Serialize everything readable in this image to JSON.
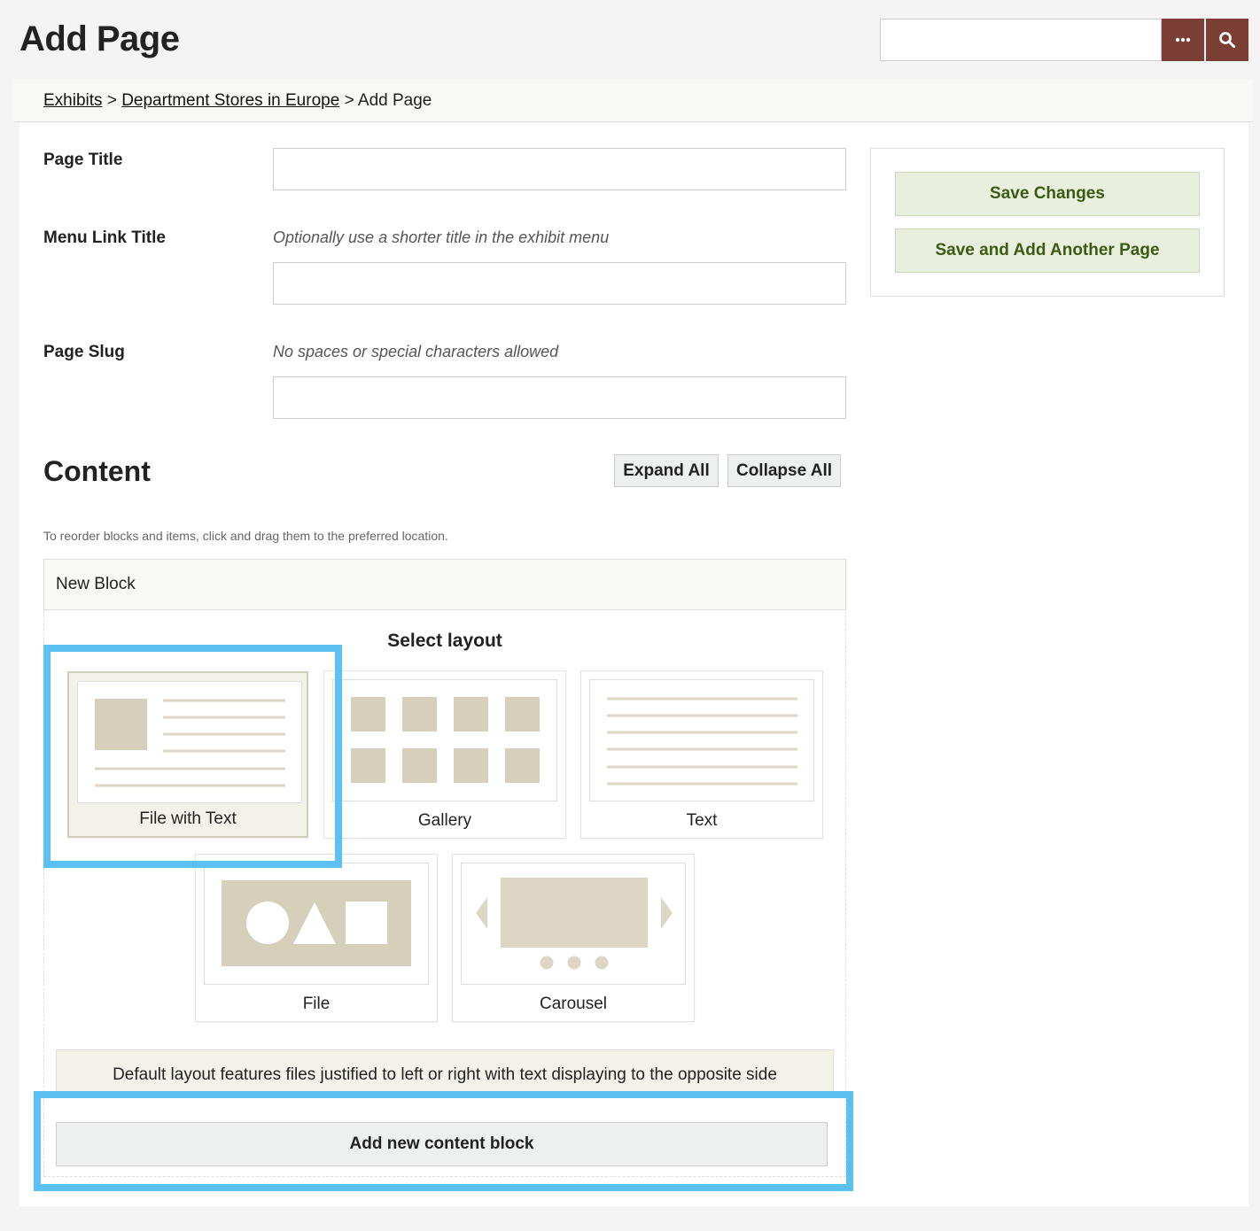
{
  "header": {
    "title": "Add Page"
  },
  "search": {
    "value": "",
    "options_icon": "ellipsis-icon",
    "submit_icon": "magnifier-icon",
    "button_color": "#7a3e35"
  },
  "breadcrumb": {
    "items": [
      {
        "label": "Exhibits",
        "link": true
      },
      {
        "label": "Department Stores in Europe",
        "link": true
      },
      {
        "label": "Add Page",
        "link": false
      }
    ],
    "separator": ">"
  },
  "form": {
    "page_title": {
      "label": "Page Title",
      "value": ""
    },
    "menu_link_title": {
      "label": "Menu Link Title",
      "hint": "Optionally use a shorter title in the exhibit menu",
      "value": ""
    },
    "page_slug": {
      "label": "Page Slug",
      "hint": "No spaces or special characters allowed",
      "value": ""
    }
  },
  "actions": {
    "save_changes": "Save Changes",
    "save_add_another": "Save and Add Another Page",
    "accent": "#3c5a14",
    "bg": "#e8f0dd"
  },
  "content": {
    "heading": "Content",
    "expand_all": "Expand All",
    "collapse_all": "Collapse All",
    "reorder_hint": "To reorder blocks and items, click and drag them to the preferred location.",
    "block": {
      "title": "New Block",
      "select_layout": "Select layout",
      "layouts": [
        {
          "name": "File with Text",
          "selected": true
        },
        {
          "name": "Gallery",
          "selected": false
        },
        {
          "name": "Text",
          "selected": false
        },
        {
          "name": "File",
          "selected": false
        },
        {
          "name": "Carousel",
          "selected": false
        }
      ],
      "description": "Default layout features files justified to left or right with text displaying to the opposite side"
    },
    "add_block": "Add new content block"
  },
  "colors": {
    "thumb_fill": "#d6d0bb",
    "highlight": "#5bc0f2"
  }
}
